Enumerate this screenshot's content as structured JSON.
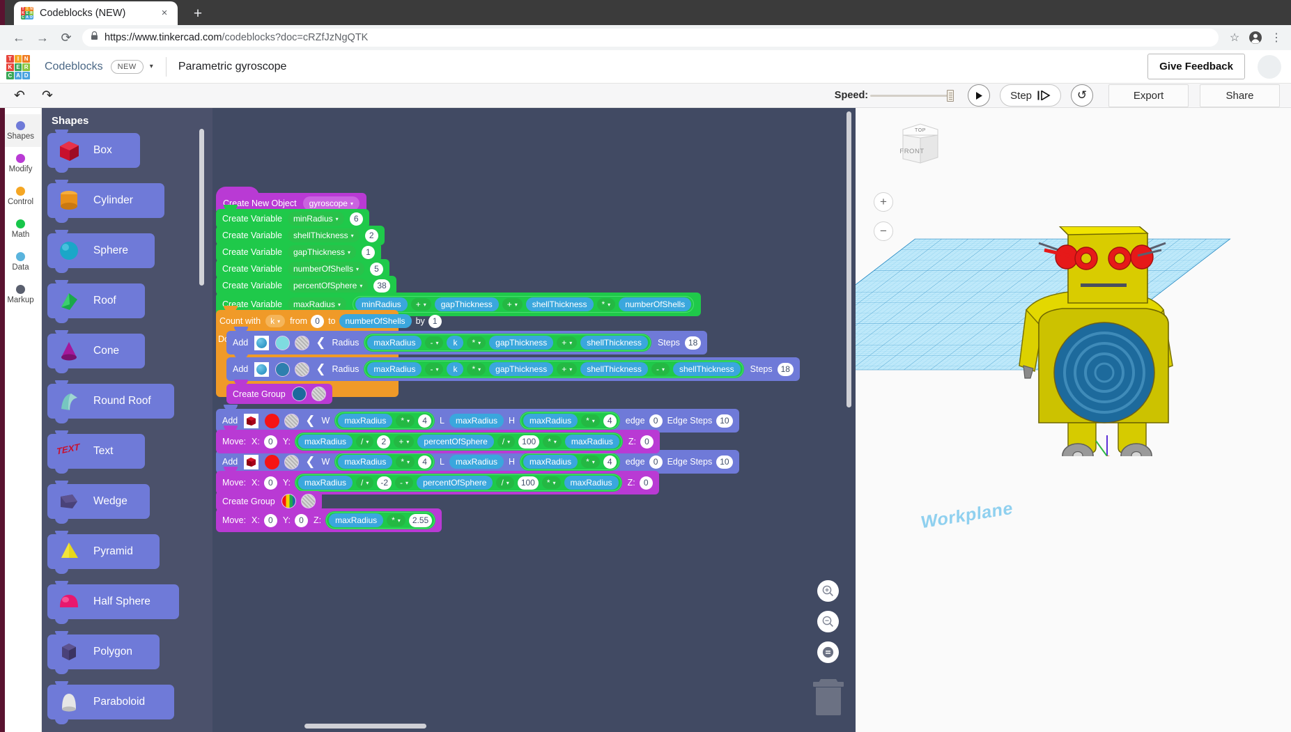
{
  "browser": {
    "tab_title": "Codeblocks (NEW)",
    "favicon_letters": [
      "T",
      "I",
      "N",
      "K",
      "E",
      "R",
      "C",
      "A",
      "D"
    ],
    "favicon_colors": [
      "#e8453c",
      "#f5a623",
      "#f07c22",
      "#e8453c",
      "#3aa757",
      "#8bc53f",
      "#3aa757",
      "#4aa3df",
      "#4aa3df"
    ],
    "close_label": "×",
    "new_tab_label": "+",
    "url_domain": "https://www.tinkercad.com",
    "url_path": "/codeblocks?doc=cRZfJzNgQTK",
    "back_label": "←",
    "forward_label": "→",
    "reload_label": "⟳",
    "star_label": "☆",
    "menu_label": "⋮"
  },
  "header": {
    "logo_letters": [
      "T",
      "I",
      "N",
      "K",
      "E",
      "R",
      "C",
      "A",
      "D"
    ],
    "logo_colors": [
      "#e8453c",
      "#f5a623",
      "#f07c22",
      "#e8453c",
      "#3aa757",
      "#8bc53f",
      "#3aa757",
      "#4aa3df",
      "#4aa3df"
    ],
    "app_name": "Codeblocks",
    "new_badge": "NEW",
    "caret": "▾",
    "doc_title": "Parametric gyroscope",
    "feedback_label": "Give Feedback"
  },
  "action_bar": {
    "undo_label": "↶",
    "redo_label": "↷",
    "speed_label": "Speed:",
    "play_label": "▶",
    "step_label": "Step",
    "restart_label": "↺",
    "export_label": "Export",
    "share_label": "Share"
  },
  "categories": [
    {
      "label": "Shapes",
      "color": "#6f7ad8",
      "active": true
    },
    {
      "label": "Modify",
      "color": "#b93ad4",
      "active": false
    },
    {
      "label": "Control",
      "color": "#f5a623",
      "active": false
    },
    {
      "label": "Math",
      "color": "#17c64a",
      "active": false
    },
    {
      "label": "Data",
      "color": "#5ab4dd",
      "active": false
    },
    {
      "label": "Markup",
      "color": "#5a5f6e",
      "active": false
    }
  ],
  "shapes_panel": {
    "title": "Shapes",
    "items": [
      {
        "label": "Box",
        "color": "#c8102e"
      },
      {
        "label": "Cylinder",
        "color": "#e8901a"
      },
      {
        "label": "Sphere",
        "color": "#1aa7c8"
      },
      {
        "label": "Roof",
        "color": "#1aa84a"
      },
      {
        "label": "Cone",
        "color": "#a3189b"
      },
      {
        "label": "Round Roof",
        "color": "#76c6c0"
      },
      {
        "label": "Text",
        "color": "#c8102e"
      },
      {
        "label": "Wedge",
        "color": "#4a4279"
      },
      {
        "label": "Pyramid",
        "color": "#e8d81a"
      },
      {
        "label": "Half Sphere",
        "color": "#e8186e"
      },
      {
        "label": "Polygon",
        "color": "#4a4279"
      },
      {
        "label": "Paraboloid",
        "color": "#e6e6e6"
      }
    ]
  },
  "code": {
    "create_object": {
      "label": "Create New Object",
      "target": "gyroscope",
      "caret": "▾"
    },
    "variables": [
      {
        "label": "Create Variable",
        "name": "minRadius",
        "caret": "▾",
        "value": "6"
      },
      {
        "label": "Create Variable",
        "name": "shellThickness",
        "caret": "▾",
        "value": "2"
      },
      {
        "label": "Create Variable",
        "name": "gapThickness",
        "caret": "▾",
        "value": "1"
      },
      {
        "label": "Create Variable",
        "name": "numberOfShells",
        "caret": "▾",
        "value": "5"
      },
      {
        "label": "Create Variable",
        "name": "percentOfSphere",
        "caret": "▾",
        "value": "38"
      }
    ],
    "max_radius": {
      "label": "Create Variable",
      "name": "maxRadius",
      "caret": "▾",
      "terms": [
        "minRadius",
        "+",
        "gapThickness",
        "+",
        "shellThickness",
        "*",
        "numberOfShells"
      ]
    },
    "loop": {
      "count_with": "Count with",
      "counter": "k",
      "caret": "▾",
      "from_label": "from",
      "from_value": "0",
      "to_label": "to",
      "to_value": "numberOfShells",
      "by_label": "by",
      "by_value": "1",
      "do_label": "Do"
    },
    "sphere_outer": {
      "add_label": "Add",
      "radius_label": "Radius",
      "terms": [
        "maxRadius",
        "-",
        "k",
        "*",
        "gapThickness",
        "+",
        "shellThickness"
      ],
      "steps_label": "Steps",
      "steps_value": "18"
    },
    "sphere_inner": {
      "add_label": "Add",
      "radius_label": "Radius",
      "terms": [
        "maxRadius",
        "-",
        "k",
        "*",
        "gapThickness",
        "+",
        "shellThickness",
        "-",
        "shellThickness"
      ],
      "steps_label": "Steps",
      "steps_value": "18"
    },
    "group_shells": {
      "label": "Create Group"
    },
    "box_top": {
      "add_label": "Add",
      "w_label": "W",
      "w_terms": [
        "maxRadius",
        "*",
        "4"
      ],
      "l_label": "L",
      "l_value": "maxRadius",
      "h_label": "H",
      "h_terms": [
        "maxRadius",
        "*",
        "4"
      ],
      "edge_label": "edge",
      "edge_value": "0",
      "edge_steps_label": "Edge Steps",
      "edge_steps_value": "10"
    },
    "move_top": {
      "label": "Move:",
      "x_label": "X:",
      "x_value": "0",
      "y_label": "Y:",
      "y_terms": [
        "maxRadius",
        "/",
        "2",
        "+",
        "percentOfSphere",
        "/",
        "100",
        "*",
        "maxRadius"
      ],
      "z_label": "Z:",
      "z_value": "0"
    },
    "box_bottom": {
      "add_label": "Add",
      "w_label": "W",
      "w_terms": [
        "maxRadius",
        "*",
        "4"
      ],
      "l_label": "L",
      "l_value": "maxRadius",
      "h_label": "H",
      "h_terms": [
        "maxRadius",
        "*",
        "4"
      ],
      "edge_label": "edge",
      "edge_value": "0",
      "edge_steps_label": "Edge Steps",
      "edge_steps_value": "10"
    },
    "move_bottom": {
      "label": "Move:",
      "x_label": "X:",
      "x_value": "0",
      "y_label": "Y:",
      "y_terms": [
        "maxRadius",
        "/",
        "-2",
        "-",
        "percentOfSphere",
        "/",
        "100",
        "*",
        "maxRadius"
      ],
      "z_label": "Z:",
      "z_value": "0"
    },
    "group_all": {
      "label": "Create Group"
    },
    "move_final": {
      "label": "Move:",
      "x_label": "X:",
      "x_value": "0",
      "y_label": "Y:",
      "y_value": "0",
      "z_label": "Z:",
      "z_terms": [
        "maxRadius",
        "*",
        "2.55"
      ]
    }
  },
  "viewport": {
    "cube_top_label": "TOP",
    "cube_front_label": "FRONT",
    "zoom_in_label": "+",
    "zoom_out_label": "−",
    "workplane_label": "Workplane",
    "vp_zoom_in_name": "zoom-in",
    "vp_zoom_out_name": "zoom-out",
    "vp_fit_label": "=",
    "trash_name": "trash"
  },
  "colors": {
    "canvas_bg": "#414a63",
    "panel_bg": "#4b516b",
    "shape_block": "#6f7ad8",
    "green": "#1fc94a",
    "purple": "#b93ad4",
    "orange": "#f09a28",
    "blue_var": "#3aa7dd"
  }
}
